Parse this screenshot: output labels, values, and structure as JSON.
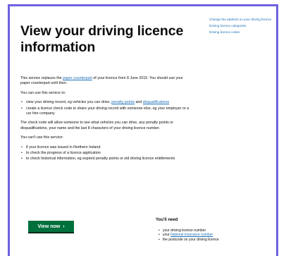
{
  "page": {
    "title": "View your driving licence information"
  },
  "related_links": [
    "Change the address on your driving licence",
    "Driving licence categories",
    "Driving licence codes"
  ],
  "intro": {
    "before": "This service replaces the ",
    "link": "paper counterpart",
    "after": " of your licence from 8 June 2015. You should use your paper counterpart until then."
  },
  "use_heading": "You can use this service to:",
  "use_items": [
    {
      "before": "view your driving record, eg vehicles you can drive, ",
      "link1": "penalty points",
      "middle": " and ",
      "link2": "disqualifications"
    },
    {
      "text": "create a licence check code to share your driving record with someone else, eg your employer or a car hire company"
    }
  ],
  "check_code_text": "The check code will allow someone to see what vehicles you can drive, any penalty points or disqualifications, your name and the last 8 characters of your driving licence number.",
  "cant_heading": "You can't use this service:",
  "cant_items": [
    "if your licence was issued in Northern Ireland",
    "to check the progress of a licence application",
    "to check historical information, eg expired penalty points or old driving licence entitlements"
  ],
  "start_button": {
    "label": "View now",
    "arrow": "›"
  },
  "you_need": {
    "heading": "You'll need",
    "items": [
      {
        "text": "your driving licence number"
      },
      {
        "before": "your ",
        "link": "National Insurance number"
      },
      {
        "text": "the postcode on your driving licence"
      }
    ]
  },
  "colors": {
    "frame": "#6e62e0",
    "link": "#1d70b8",
    "button": "#00703c"
  }
}
